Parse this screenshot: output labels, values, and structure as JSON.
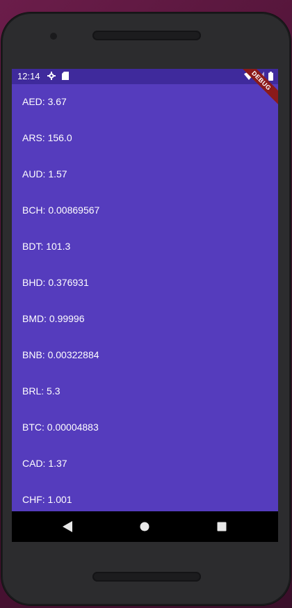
{
  "status_bar": {
    "time": "12:14",
    "icons": [
      "gear-icon",
      "sd-card-icon",
      "wifi-icon",
      "signal-icon",
      "battery-icon"
    ]
  },
  "debug_banner": "DEBUG",
  "rates": [
    {
      "label": "AED: 3.67"
    },
    {
      "label": "ARS: 156.0"
    },
    {
      "label": "AUD: 1.57"
    },
    {
      "label": "BCH: 0.00869567"
    },
    {
      "label": "BDT: 101.3"
    },
    {
      "label": "BHD: 0.376931"
    },
    {
      "label": "BMD: 0.99996"
    },
    {
      "label": "BNB: 0.00322884"
    },
    {
      "label": "BRL: 5.3"
    },
    {
      "label": "BTC: 0.00004883"
    },
    {
      "label": "CAD: 1.37"
    },
    {
      "label": "CHF: 1.001"
    }
  ],
  "nav_bar": {
    "buttons": [
      "back-icon",
      "home-icon",
      "recents-icon"
    ]
  },
  "colors": {
    "app_background": "#553cbd",
    "status_bar": "#3f2a9c",
    "text": "#ffffff",
    "nav_bar": "#000000",
    "debug_banner": "#8b1a1a"
  }
}
